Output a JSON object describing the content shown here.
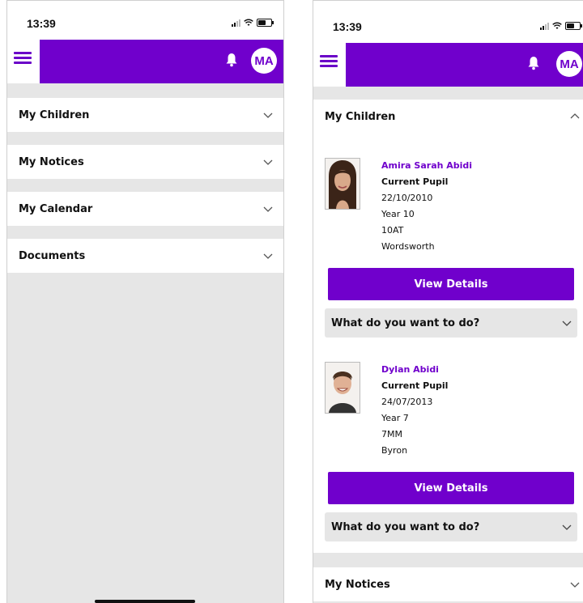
{
  "left_screen": {
    "status_time": "13:39",
    "avatar_initials": "MA",
    "sections": [
      {
        "label": "My Children"
      },
      {
        "label": "My Notices"
      },
      {
        "label": "My Calendar"
      },
      {
        "label": "Documents"
      }
    ]
  },
  "right_screen": {
    "status_time": "13:39",
    "avatar_initials": "MA",
    "expanded_section": "My Children",
    "children": [
      {
        "name": "Amira Sarah Abidi",
        "status": "Current Pupil",
        "dob": "22/10/2010",
        "year": "Year 10",
        "form": "10AT",
        "house": "Wordsworth",
        "view_label": "View Details",
        "action_label": "What do you want to do?"
      },
      {
        "name": "Dylan Abidi",
        "status": "Current Pupil",
        "dob": "24/07/2013",
        "year": "Year 7",
        "form": "7MM",
        "house": "Byron",
        "view_label": "View Details",
        "action_label": "What do you want to do?"
      }
    ],
    "next_section": "My Notices"
  },
  "colors": {
    "brand_purple": "#7000cc",
    "background_grey": "#e6e6e6"
  },
  "icons": [
    "menu-icon",
    "bell-icon",
    "chevron-down-icon",
    "chevron-up-icon",
    "signal-icon",
    "wifi-icon",
    "battery-icon"
  ]
}
